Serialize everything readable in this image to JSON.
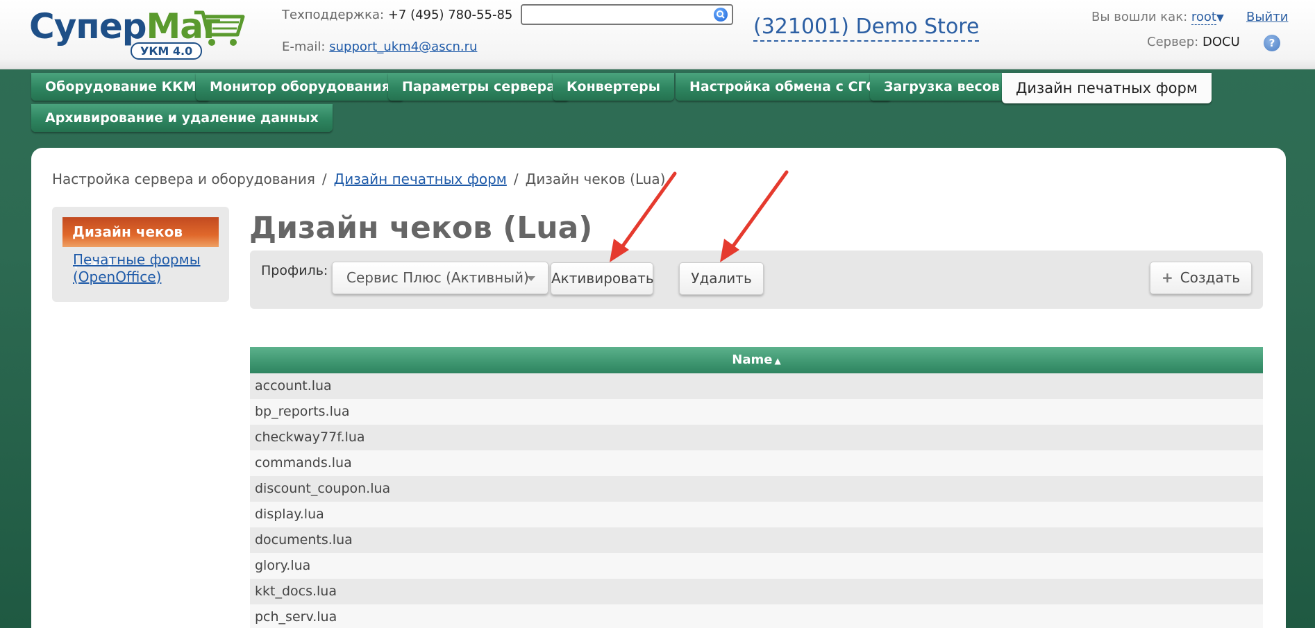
{
  "header": {
    "logo": {
      "part1": "Супер",
      "part2": "Маг",
      "badge": "УКМ 4.0"
    },
    "support_phone_label": "Техподдержка:",
    "support_phone": "+7 (495) 780-55-85",
    "support_email_label": "E-mail:",
    "support_email": "support_ukm4@ascn.ru",
    "search_placeholder": "",
    "store": "(321001) Demo Store",
    "login_label": "Вы вошли как:",
    "login_user": "root",
    "logout": "Выйти",
    "server_label": "Сервер:",
    "server_value": "DOCU",
    "help": "?"
  },
  "tabs": [
    {
      "label": "Оборудование ККМ"
    },
    {
      "label": "Монитор оборудования"
    },
    {
      "label": "Параметры сервера"
    },
    {
      "label": "Конвертеры"
    },
    {
      "label": "Настройка обмена с СГО"
    },
    {
      "label": "Загрузка весов"
    },
    {
      "label": "Дизайн печатных форм",
      "active": true
    },
    {
      "label": "Архивирование и удаление данных"
    }
  ],
  "breadcrumb": {
    "root": "Настройка сервера и оборудования",
    "link": "Дизайн печатных форм",
    "current": "Дизайн чеков (Lua)",
    "separator": "/"
  },
  "sidenav": {
    "active": "Дизайн чеков (Lua)",
    "link": "Печатные формы (OpenOffice)"
  },
  "page_title": "Дизайн чеков (Lua)",
  "toolbar": {
    "profile_label": "Профиль:",
    "profile_value": "Сервис Плюс (Активный)",
    "activate": "Активировать",
    "delete": "Удалить",
    "create": "Создать",
    "create_icon": "+"
  },
  "table": {
    "column": "Name",
    "sort_icon": "▲",
    "rows": [
      "account.lua",
      "bp_reports.lua",
      "checkway77f.lua",
      "commands.lua",
      "discount_coupon.lua",
      "display.lua",
      "documents.lua",
      "glory.lua",
      "kkt_docs.lua",
      "pch_serv.lua"
    ]
  },
  "colors": {
    "background_green": "#2d6a52",
    "tab_green": "#2e8560",
    "link_blue": "#1e5aa8",
    "active_orange": "#e0682b",
    "arrow_red": "#e53a2e"
  }
}
